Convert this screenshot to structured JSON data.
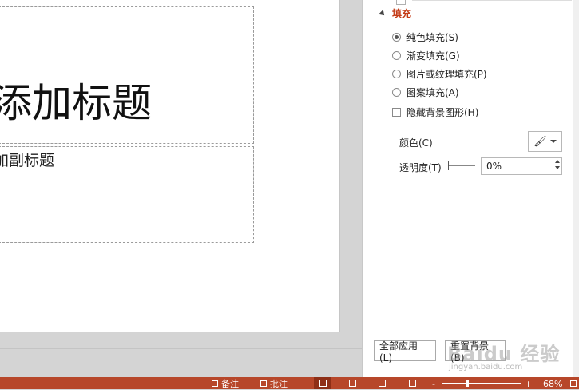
{
  "slide": {
    "title_placeholder": "添加标题",
    "subtitle_placeholder": "加副标题"
  },
  "pane": {
    "section_title": "填充",
    "fill_options": [
      {
        "label": "纯色填充(S)",
        "checked": true
      },
      {
        "label": "渐变填充(G)",
        "checked": false
      },
      {
        "label": "图片或纹理填充(P)",
        "checked": false
      },
      {
        "label": "图案填充(A)",
        "checked": false
      }
    ],
    "hide_background_label": "隐藏背景图形(H)",
    "color_label": "颜色(C)",
    "color_icon": "paint-bucket-icon",
    "transparency_label": "透明度(T)",
    "transparency_value": "0%",
    "apply_all_label": "全部应用(L)",
    "reset_label": "重置背景(B)"
  },
  "statusbar": {
    "notes_label": "备注",
    "comments_label": "批注",
    "zoom_minus": "-",
    "zoom_plus": "+",
    "zoom_value": "68%",
    "accent_color": "#b7472a"
  },
  "watermark": {
    "text": "Baidu 经验",
    "url": "jingyan.baidu.com"
  }
}
